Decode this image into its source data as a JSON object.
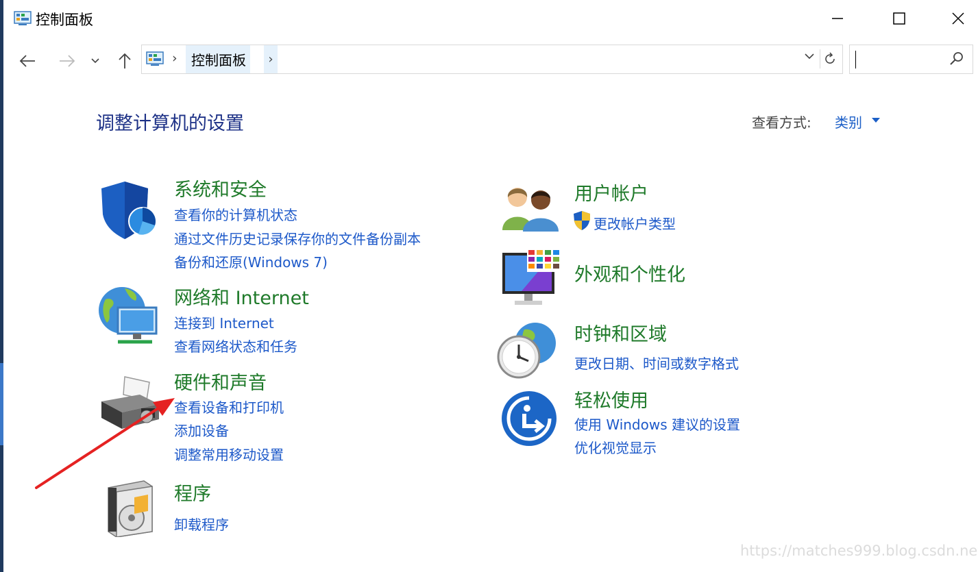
{
  "window": {
    "title": "控制面板",
    "minimize_glyph": "—",
    "close_glyph": "✕"
  },
  "navbar": {
    "breadcrumb": [
      "控制面板"
    ],
    "search_placeholder": ""
  },
  "main": {
    "heading": "调整计算机的设置",
    "view_by_label": "查看方式:",
    "view_by_value": "类别"
  },
  "categories_left": [
    {
      "title": "系统和安全",
      "icon": "shield-icon",
      "links": [
        "查看你的计算机状态",
        "通过文件历史记录保存你的文件备份副本",
        "备份和还原(Windows 7)"
      ]
    },
    {
      "title": "网络和 Internet",
      "icon": "network-globe-icon",
      "links": [
        "连接到 Internet",
        "查看网络状态和任务"
      ]
    },
    {
      "title": "硬件和声音",
      "icon": "printer-icon",
      "links": [
        "查看设备和打印机",
        "添加设备",
        "调整常用移动设置"
      ]
    },
    {
      "title": "程序",
      "icon": "programs-disc-icon",
      "links": [
        "卸载程序"
      ]
    }
  ],
  "categories_right": [
    {
      "title": "用户帐户",
      "icon": "users-icon",
      "links": [
        "更改帐户类型"
      ]
    },
    {
      "title": "外观和个性化",
      "icon": "monitor-palette-icon",
      "links": []
    },
    {
      "title": "时钟和区域",
      "icon": "clock-globe-icon",
      "links": [
        "更改日期、时间或数字格式"
      ]
    },
    {
      "title": "轻松使用",
      "icon": "ease-of-access-icon",
      "links": [
        "使用 Windows 建议的设置",
        "优化视觉显示"
      ]
    }
  ],
  "watermark": "https://matches999.blog.csdn.net",
  "colors": {
    "category_title": "#1f7a2a",
    "link": "#1d59c9",
    "heading": "#1e3287",
    "annotation_arrow": "#e52222"
  }
}
